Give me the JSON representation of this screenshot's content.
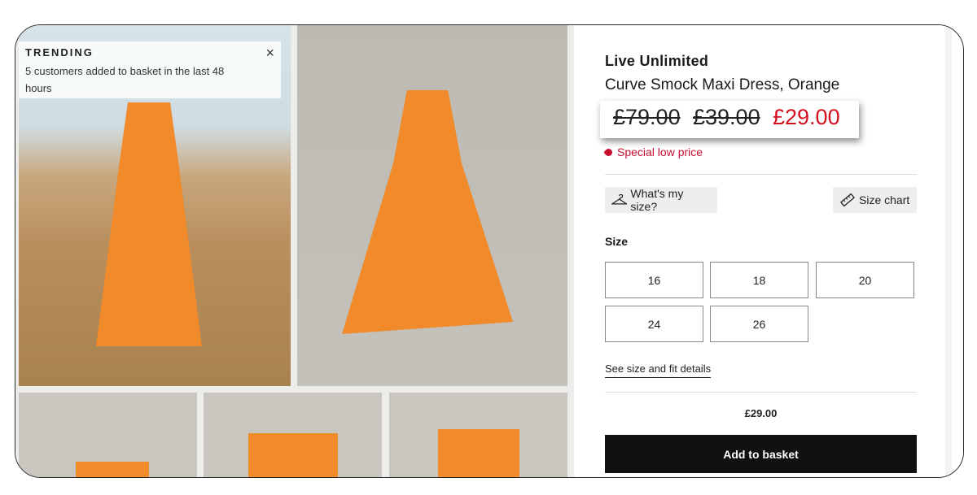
{
  "trending": {
    "title": "TRENDING",
    "text": "5 customers added to basket in the last 48 hours",
    "close": "×"
  },
  "product": {
    "brand": "Live Unlimited",
    "title": "Curve Smock Maxi Dress, Orange",
    "price_was_1": "£79.00",
    "price_was_2": "£39.00",
    "price_now": "£29.00",
    "special": "Special low price"
  },
  "actions": {
    "whats_my_size": "What's my size?",
    "size_chart": "Size chart"
  },
  "sizes": {
    "label": "Size",
    "options": [
      "16",
      "18",
      "20",
      "24",
      "26"
    ]
  },
  "fit_link": "See size and fit details",
  "summary_price": "£29.00",
  "add_to_basket": "Add to basket",
  "colors": {
    "sale_red": "#d4101e",
    "button_black": "#111111",
    "dress_orange": "#f08a2a"
  }
}
